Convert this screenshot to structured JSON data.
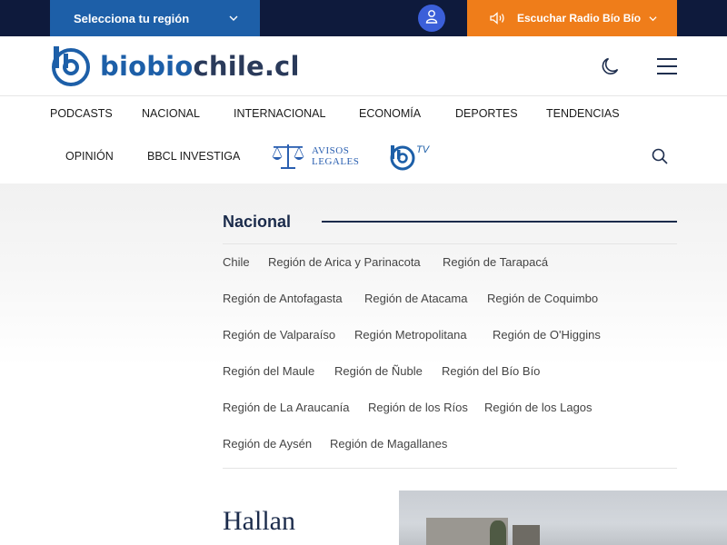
{
  "topbar": {
    "region_select_label": "Selecciona tu región",
    "radio_label": "Escuchar Radio Bío Bío",
    "colors": {
      "bar": "#0e1a3c",
      "region": "#1d5fa8",
      "radio": "#ef7d1a",
      "user": "#3b5fd9"
    }
  },
  "header": {
    "logo_part1": "biobio",
    "logo_part2": "chile.cl"
  },
  "nav": {
    "row1": [
      "PODCASTS",
      "NACIONAL",
      "INTERNACIONAL",
      "ECONOMÍA",
      "DEPORTES",
      "TENDENCIAS"
    ],
    "row2": [
      "OPINIÓN",
      "BBCL INVESTIGA"
    ],
    "avisos_line1": "AVISOS",
    "avisos_line2": "LEGALES",
    "tv_label": "TV"
  },
  "section": {
    "title": "Nacional",
    "regions": [
      "Chile",
      "Región de Arica y Parinacota",
      "Región de Tarapacá",
      "Región de Antofagasta",
      "Región de Atacama",
      "Región de Coquimbo",
      "Región de Valparaíso",
      "Región Metropolitana",
      "Región de O'Higgins",
      "Región del Maule",
      "Región de Ñuble",
      "Región del Bío Bío",
      "Región de La Araucanía",
      "Región de los Ríos",
      "Región de los Lagos",
      "Región de Aysén",
      "Región de Magallanes"
    ]
  },
  "article": {
    "headline": "Hallan"
  }
}
